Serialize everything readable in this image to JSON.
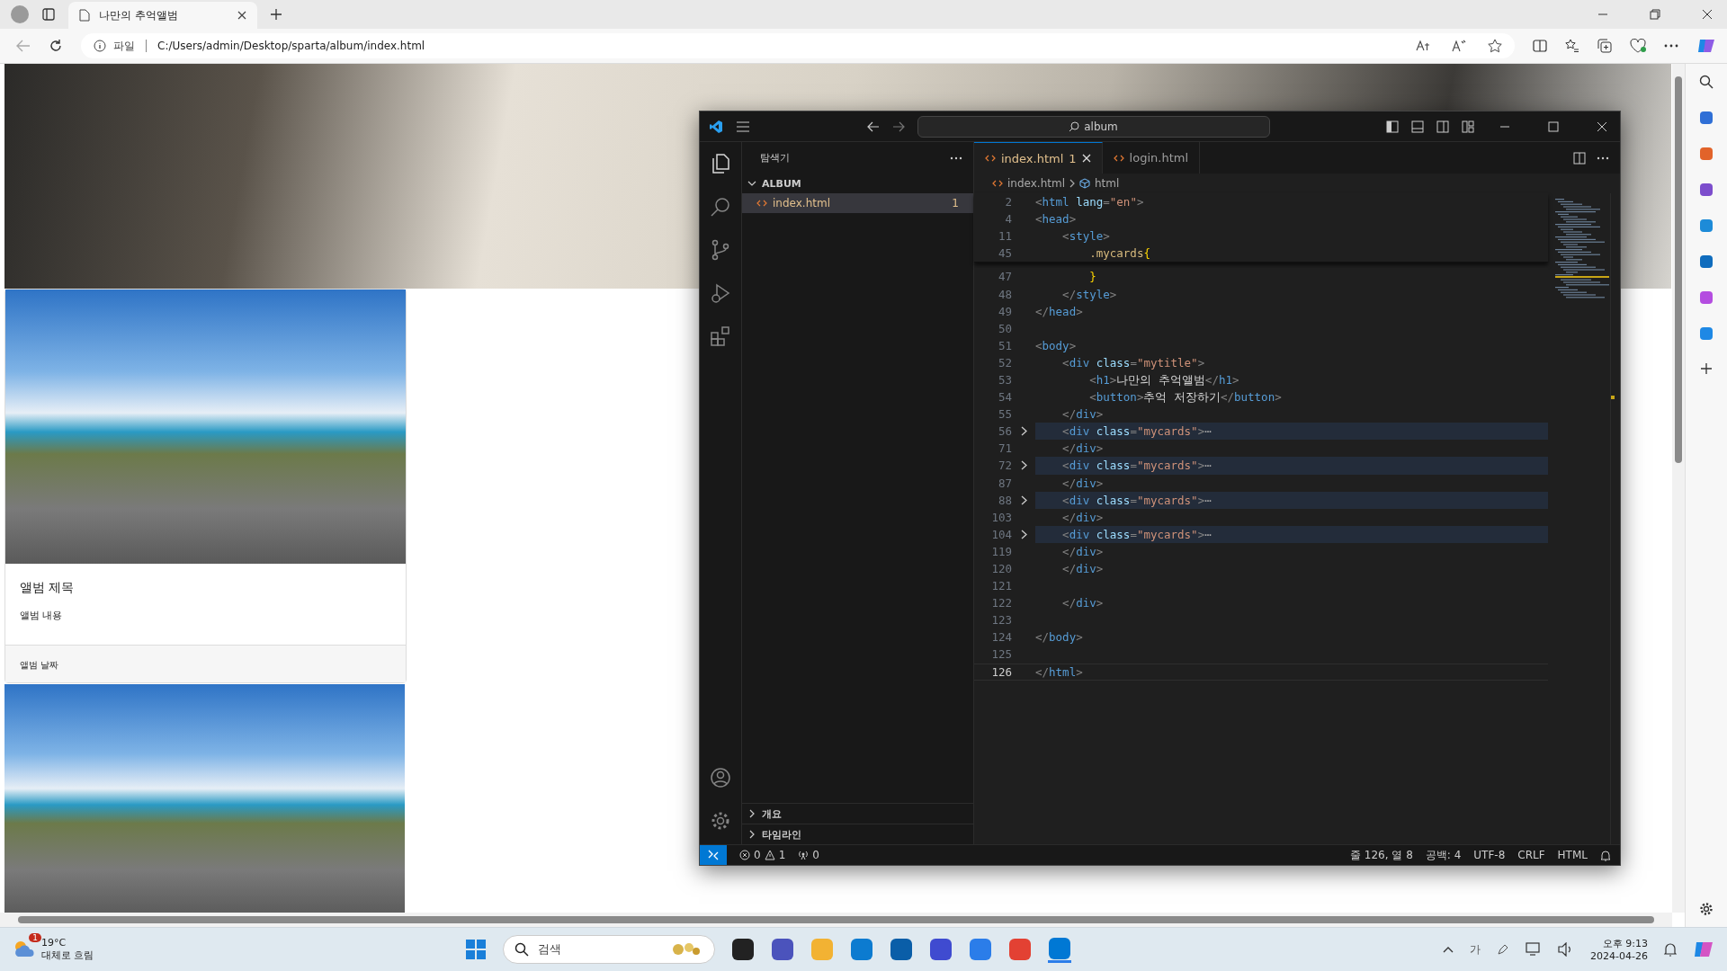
{
  "browser": {
    "tab_title": "나만의 추억앨범",
    "address_scheme": "파일",
    "url": "C:/Users/admin/Desktop/sparta/album/index.html"
  },
  "page": {
    "card": {
      "title": "앨범 제목",
      "content": "앨범 내용",
      "date": "앨범 날짜"
    }
  },
  "vscode": {
    "search": "album",
    "explorer_title": "탐색기",
    "folder": "ALBUM",
    "files": [
      {
        "name": "index.html",
        "badge": "1",
        "selected": true
      }
    ],
    "tabs": [
      {
        "label": "index.html",
        "badge": "1",
        "selected": true
      },
      {
        "label": "login.html",
        "selected": false
      }
    ],
    "breadcrumbs": [
      "index.html",
      "html"
    ],
    "sticky_lines": [
      {
        "number": "2",
        "tokens": [
          {
            "kind": "punct",
            "text": "<"
          },
          {
            "kind": "tag",
            "text": "html"
          },
          {
            "kind": "attr",
            "text": " lang"
          },
          {
            "kind": "punct",
            "text": "="
          },
          {
            "kind": "str",
            "text": "\"en\""
          },
          {
            "kind": "punct",
            "text": ">"
          }
        ]
      },
      {
        "number": "4",
        "tokens": [
          {
            "kind": "punct",
            "text": "<"
          },
          {
            "kind": "tag",
            "text": "head"
          },
          {
            "kind": "punct",
            "text": ">"
          }
        ]
      },
      {
        "number": "11",
        "tokens": [
          {
            "kind": "punct",
            "text": "    <"
          },
          {
            "kind": "tag",
            "text": "style"
          },
          {
            "kind": "punct",
            "text": ">"
          }
        ]
      },
      {
        "number": "45",
        "tokens": [
          {
            "kind": "selector",
            "text": "        .mycards"
          },
          {
            "kind": "brace",
            "text": "{"
          }
        ]
      }
    ],
    "lines": [
      {
        "number": "47",
        "folded": false,
        "current": false,
        "tokens": [
          {
            "kind": "brace",
            "text": "        }"
          }
        ]
      },
      {
        "number": "48",
        "folded": false,
        "current": false,
        "tokens": [
          {
            "kind": "punct",
            "text": "    </"
          },
          {
            "kind": "tag",
            "text": "style"
          },
          {
            "kind": "punct",
            "text": ">"
          }
        ]
      },
      {
        "number": "49",
        "folded": false,
        "current": false,
        "tokens": [
          {
            "kind": "punct",
            "text": "</"
          },
          {
            "kind": "tag",
            "text": "head"
          },
          {
            "kind": "punct",
            "text": ">"
          }
        ]
      },
      {
        "number": "50",
        "folded": false,
        "current": false
      },
      {
        "number": "51",
        "folded": false,
        "current": false,
        "tokens": [
          {
            "kind": "punct",
            "text": "<"
          },
          {
            "kind": "tag",
            "text": "body"
          },
          {
            "kind": "punct",
            "text": ">"
          }
        ]
      },
      {
        "number": "52",
        "folded": false,
        "current": false,
        "tokens": [
          {
            "kind": "punct",
            "text": "    <"
          },
          {
            "kind": "tag",
            "text": "div"
          },
          {
            "kind": "attr",
            "text": " class"
          },
          {
            "kind": "punct",
            "text": "="
          },
          {
            "kind": "str",
            "text": "\"mytitle\""
          },
          {
            "kind": "punct",
            "text": ">"
          }
        ]
      },
      {
        "number": "53",
        "folded": false,
        "current": false,
        "tokens": [
          {
            "kind": "punct",
            "text": "        <"
          },
          {
            "kind": "tag",
            "text": "h1"
          },
          {
            "kind": "punct",
            "text": ">"
          },
          {
            "kind": "text",
            "text": "나만의 추억앨범"
          },
          {
            "kind": "punct",
            "text": "</"
          },
          {
            "kind": "tag",
            "text": "h1"
          },
          {
            "kind": "punct",
            "text": ">"
          }
        ]
      },
      {
        "number": "54",
        "folded": false,
        "current": false,
        "tokens": [
          {
            "kind": "punct",
            "text": "        <"
          },
          {
            "kind": "tag",
            "text": "button"
          },
          {
            "kind": "punct",
            "text": ">"
          },
          {
            "kind": "text",
            "text": "추억 저장하기"
          },
          {
            "kind": "punct",
            "text": "</"
          },
          {
            "kind": "tag",
            "text": "button"
          },
          {
            "kind": "punct",
            "text": ">"
          }
        ]
      },
      {
        "number": "55",
        "folded": false,
        "current": false,
        "tokens": [
          {
            "kind": "punct",
            "text": "    </"
          },
          {
            "kind": "tag",
            "text": "div"
          },
          {
            "kind": "punct",
            "text": ">"
          }
        ]
      },
      {
        "number": "56",
        "folded": true,
        "current": false,
        "tokens": [
          {
            "kind": "punct",
            "text": "    <"
          },
          {
            "kind": "tag",
            "text": "div"
          },
          {
            "kind": "attr",
            "text": " class"
          },
          {
            "kind": "punct",
            "text": "="
          },
          {
            "kind": "str",
            "text": "\"mycards\""
          },
          {
            "kind": "punct",
            "text": ">"
          },
          {
            "kind": "fold",
            "text": "⋯"
          }
        ]
      },
      {
        "number": "71",
        "folded": false,
        "current": false,
        "tokens": [
          {
            "kind": "punct",
            "text": "    </"
          },
          {
            "kind": "tag",
            "text": "div"
          },
          {
            "kind": "punct",
            "text": ">"
          }
        ]
      },
      {
        "number": "72",
        "folded": true,
        "current": false,
        "tokens": [
          {
            "kind": "punct",
            "text": "    <"
          },
          {
            "kind": "tag",
            "text": "div"
          },
          {
            "kind": "attr",
            "text": " class"
          },
          {
            "kind": "punct",
            "text": "="
          },
          {
            "kind": "str",
            "text": "\"mycards\""
          },
          {
            "kind": "punct",
            "text": ">"
          },
          {
            "kind": "fold",
            "text": "⋯"
          }
        ]
      },
      {
        "number": "87",
        "folded": false,
        "current": false,
        "tokens": [
          {
            "kind": "punct",
            "text": "    </"
          },
          {
            "kind": "tag",
            "text": "div"
          },
          {
            "kind": "punct",
            "text": ">"
          }
        ]
      },
      {
        "number": "88",
        "folded": true,
        "current": false,
        "tokens": [
          {
            "kind": "punct",
            "text": "    <"
          },
          {
            "kind": "tag",
            "text": "div"
          },
          {
            "kind": "attr",
            "text": " class"
          },
          {
            "kind": "punct",
            "text": "="
          },
          {
            "kind": "str",
            "text": "\"mycards\""
          },
          {
            "kind": "punct",
            "text": ">"
          },
          {
            "kind": "fold",
            "text": "⋯"
          }
        ]
      },
      {
        "number": "103",
        "folded": false,
        "current": false,
        "tokens": [
          {
            "kind": "punct",
            "text": "    </"
          },
          {
            "kind": "tag",
            "text": "div"
          },
          {
            "kind": "punct",
            "text": ">"
          }
        ]
      },
      {
        "number": "104",
        "folded": true,
        "current": false,
        "tokens": [
          {
            "kind": "punct",
            "text": "    <"
          },
          {
            "kind": "tag",
            "text": "div"
          },
          {
            "kind": "attr",
            "text": " class"
          },
          {
            "kind": "punct",
            "text": "="
          },
          {
            "kind": "str",
            "text": "\"mycards\""
          },
          {
            "kind": "punct",
            "text": ">"
          },
          {
            "kind": "fold",
            "text": "⋯"
          }
        ]
      },
      {
        "number": "119",
        "folded": false,
        "current": false,
        "tokens": [
          {
            "kind": "punct",
            "text": "    </"
          },
          {
            "kind": "tag",
            "text": "div"
          },
          {
            "kind": "punct",
            "text": ">"
          }
        ]
      },
      {
        "number": "120",
        "folded": false,
        "current": false,
        "tokens": [
          {
            "kind": "punct",
            "text": "    </"
          },
          {
            "kind": "tag",
            "text": "div"
          },
          {
            "kind": "punct",
            "text": ">"
          }
        ]
      },
      {
        "number": "121",
        "folded": false,
        "current": false
      },
      {
        "number": "122",
        "folded": false,
        "current": false,
        "tokens": [
          {
            "kind": "punct",
            "text": "    </"
          },
          {
            "kind": "tag",
            "text": "div"
          },
          {
            "kind": "punct",
            "text": ">"
          }
        ]
      },
      {
        "number": "123",
        "folded": false,
        "current": false
      },
      {
        "number": "124",
        "folded": false,
        "current": false,
        "tokens": [
          {
            "kind": "punct",
            "text": "</"
          },
          {
            "kind": "tag",
            "text": "body"
          },
          {
            "kind": "punct",
            "text": ">"
          }
        ]
      },
      {
        "number": "125",
        "folded": false,
        "current": false
      },
      {
        "number": "126",
        "folded": false,
        "current": true,
        "tokens": [
          {
            "kind": "punct",
            "text": "</"
          },
          {
            "kind": "tag",
            "text": "html"
          },
          {
            "kind": "punct",
            "text": ">"
          }
        ]
      }
    ],
    "panels": [
      "개요",
      "타임라인"
    ],
    "status": {
      "errors": "0",
      "warnings": "1",
      "ports": "0",
      "position": "줄 126, 열 8",
      "indent": "공백: 4",
      "encoding": "UTF-8",
      "eol": "CRLF",
      "language": "HTML"
    }
  },
  "taskbar": {
    "weather_badge": "1",
    "temperature": "19°C",
    "weather": "대체로 흐림",
    "search_placeholder": "검색",
    "ime": "가",
    "time": "오후 9:13",
    "date": "2024-04-26"
  }
}
